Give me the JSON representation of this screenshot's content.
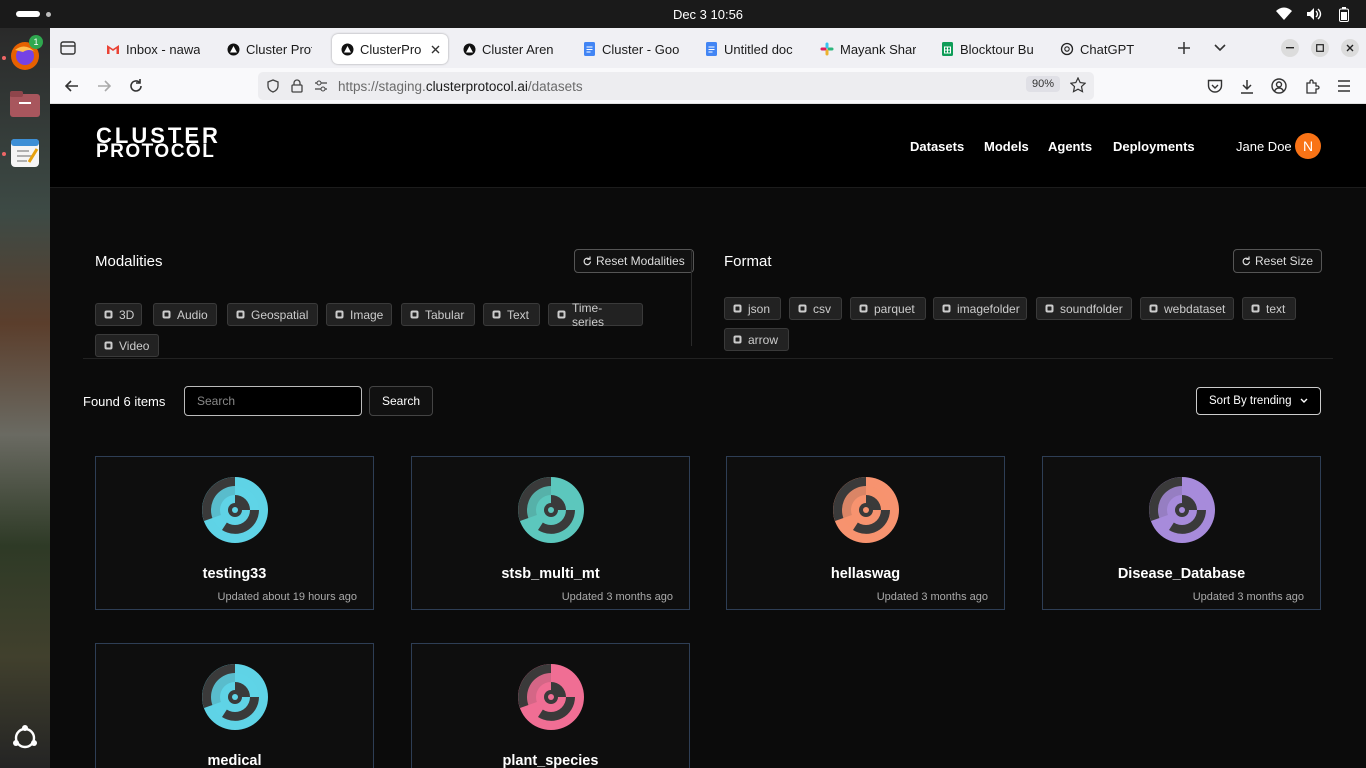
{
  "system": {
    "clock": "Dec 3  10:56",
    "dock_badge": "1"
  },
  "browser": {
    "tabs": [
      {
        "label": "Inbox - nawa",
        "icon": "gmail-icon",
        "active": false
      },
      {
        "label": "Cluster Proto",
        "icon": "cluster-icon",
        "active": false
      },
      {
        "label": "ClusterPro",
        "icon": "cluster-icon",
        "active": true
      },
      {
        "label": "Cluster Aren",
        "icon": "cluster-icon",
        "active": false
      },
      {
        "label": "Cluster - Goo",
        "icon": "docs-icon",
        "active": false
      },
      {
        "label": "Untitled doc",
        "icon": "docs-icon",
        "active": false
      },
      {
        "label": "Mayank Shar",
        "icon": "slack-icon",
        "active": false
      },
      {
        "label": "Blocktour Bu",
        "icon": "sheets-icon",
        "active": false
      },
      {
        "label": "ChatGPT",
        "icon": "chatgpt-icon",
        "active": false
      }
    ],
    "url_prefix": "https://staging.",
    "url_host": "clusterprotocol.ai",
    "url_path": "/datasets",
    "zoom": "90%"
  },
  "site": {
    "logo_line1": "CLUSTER",
    "logo_line2": "PROTOCOL",
    "nav": [
      "Datasets",
      "Models",
      "Agents",
      "Deployments"
    ],
    "user_name": "Jane Doe",
    "avatar_initial": "N",
    "avatar_color": "#f97316"
  },
  "filters": {
    "modalities_title": "Modalities",
    "reset_modalities": "Reset Modalities",
    "modalities": [
      "3D",
      "Audio",
      "Geospatial",
      "Image",
      "Tabular",
      "Text",
      "Time-series",
      "Video"
    ],
    "format_title": "Format",
    "reset_size": "Reset Size",
    "formats": [
      "json",
      "csv",
      "parquet",
      "imagefolder",
      "soundfolder",
      "webdataset",
      "text",
      "arrow"
    ]
  },
  "results": {
    "found": "Found 6 items",
    "search_placeholder": "Search",
    "search_button": "Search",
    "sort_label": "Sort By trending"
  },
  "datasets": [
    {
      "name": "testing33",
      "updated": "Updated about 19 hours ago",
      "color": "#5fd3e6"
    },
    {
      "name": "stsb_multi_mt",
      "updated": "Updated 3 months ago",
      "color": "#5cc7bd"
    },
    {
      "name": "hellaswag",
      "updated": "Updated 3 months ago",
      "color": "#f7936f"
    },
    {
      "name": "Disease_Database",
      "updated": "Updated 3 months ago",
      "color": "#a78bdb"
    },
    {
      "name": "medical",
      "updated": "",
      "color": "#5fd3e6"
    },
    {
      "name": "plant_species",
      "updated": "",
      "color": "#f06e94"
    }
  ]
}
